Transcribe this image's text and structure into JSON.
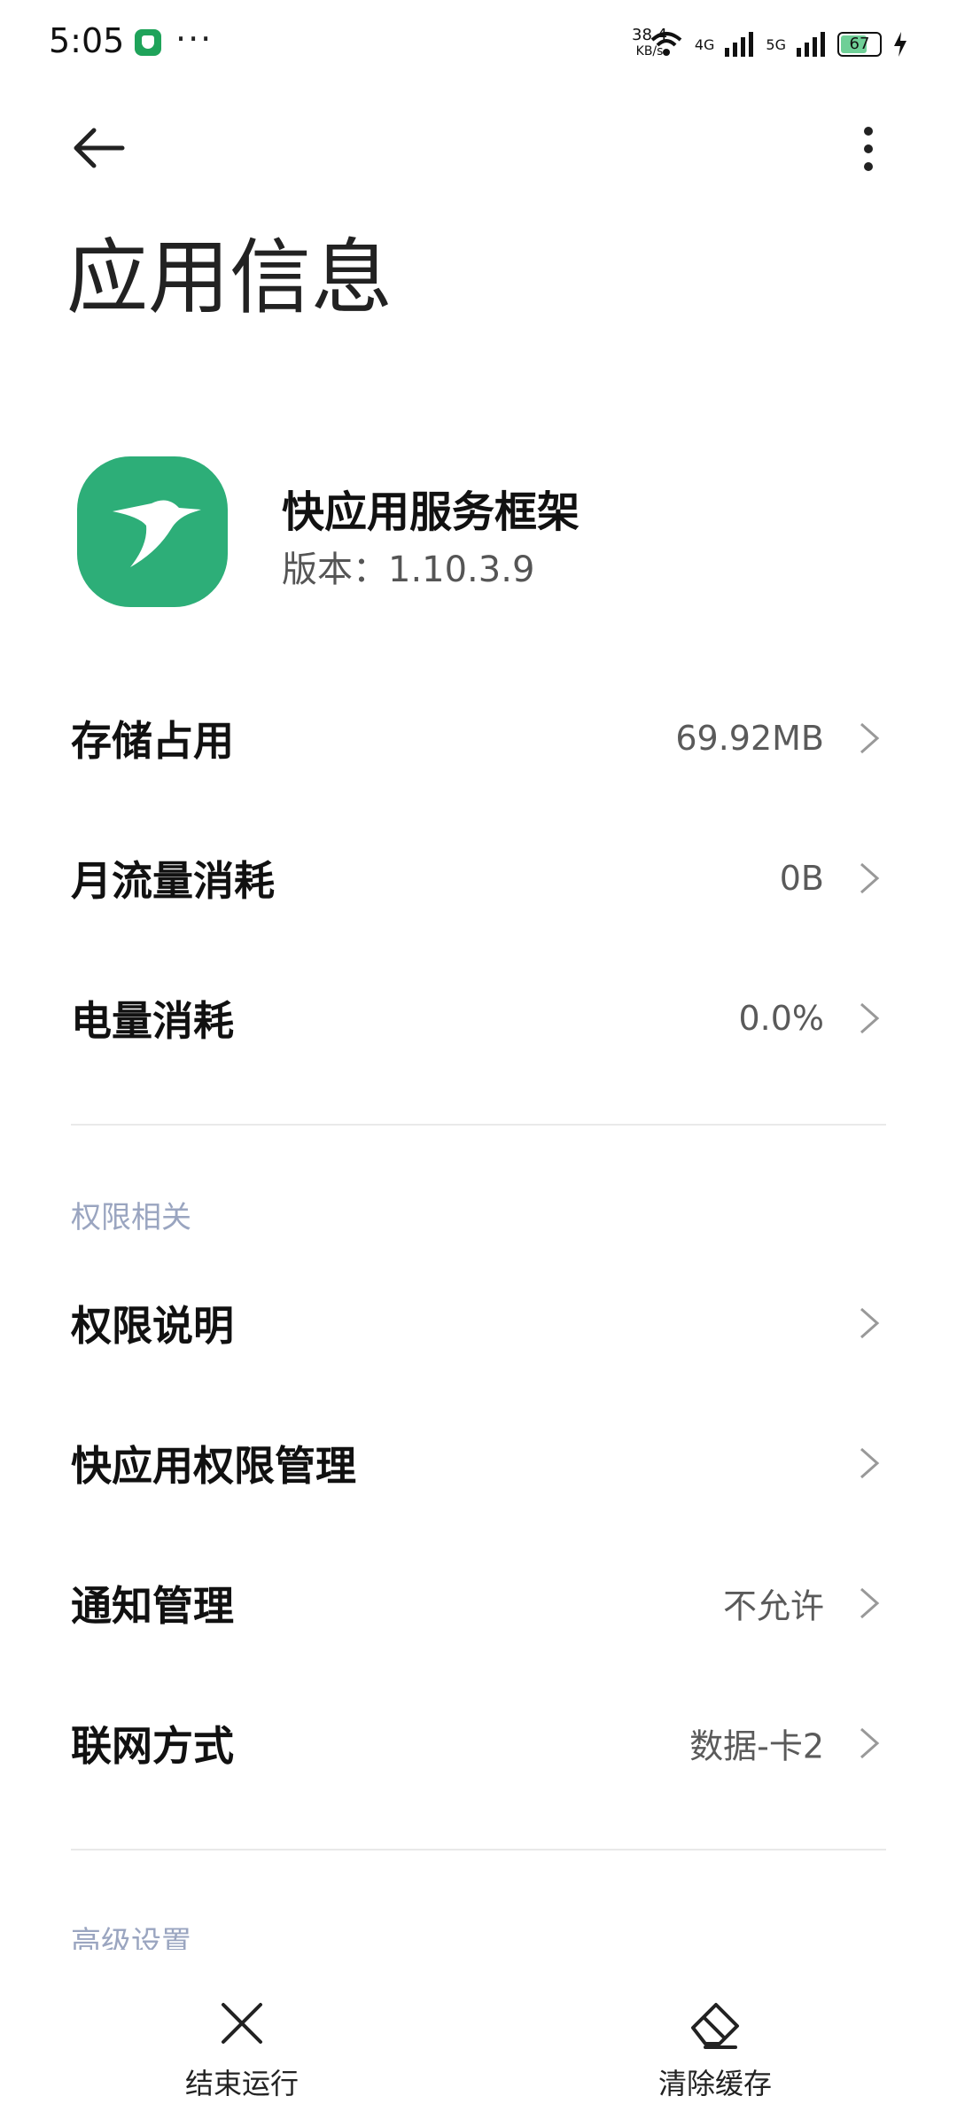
{
  "status_bar": {
    "time": "5:05",
    "net_speed_value": "38.4",
    "net_speed_unit": "KB/s",
    "signal1_label": "4G",
    "signal2_label": "5G",
    "battery": "67"
  },
  "header": {
    "back_icon": "arrow-left-icon",
    "overflow_icon": "more-vertical-icon",
    "title": "应用信息"
  },
  "app": {
    "name": "快应用服务框架",
    "version": "版本：1.10.3.9",
    "icon_color": "#2dae78"
  },
  "rows_top": [
    {
      "label": "存储占用",
      "value": "69.92MB"
    },
    {
      "label": "月流量消耗",
      "value": "0B"
    },
    {
      "label": "电量消耗",
      "value": "0.0%"
    }
  ],
  "section_permissions": "权限相关",
  "rows_permissions": [
    {
      "label": "权限说明",
      "value": ""
    },
    {
      "label": "快应用权限管理",
      "value": ""
    },
    {
      "label": "通知管理",
      "value": "不允许"
    },
    {
      "label": "联网方式",
      "value": "数据-卡2"
    }
  ],
  "section_advanced": "高级设置",
  "bottom_actions": {
    "stop_label": "结束运行",
    "clear_label": "清除缓存"
  }
}
